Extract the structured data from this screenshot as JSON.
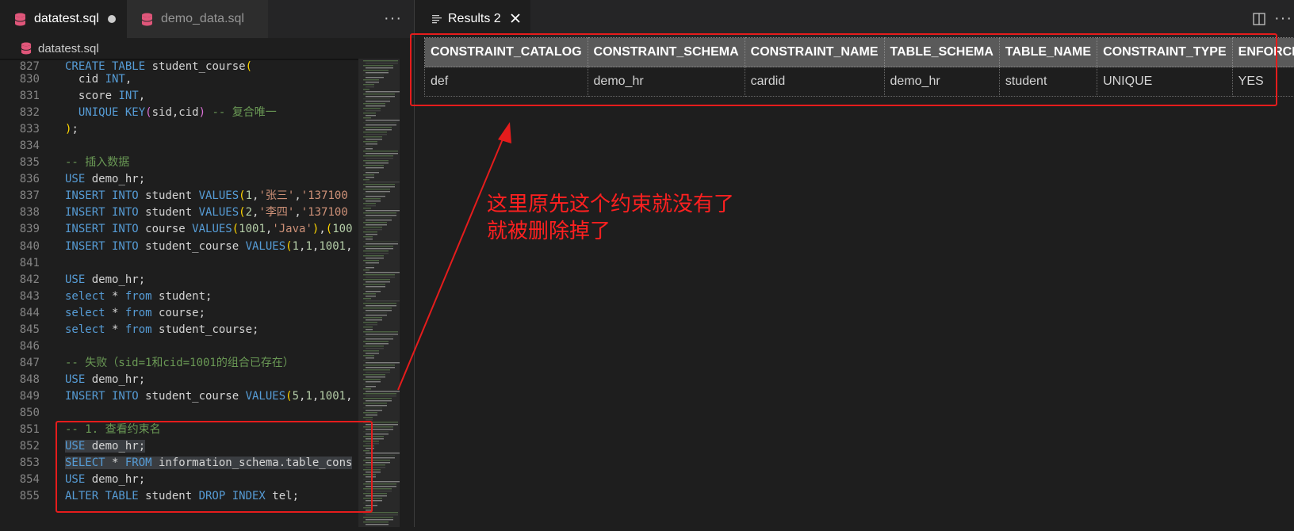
{
  "editor": {
    "tabs": [
      {
        "label": "datatest.sql",
        "active": true,
        "dirty": true
      },
      {
        "label": "demo_data.sql",
        "active": false
      }
    ],
    "more_label": "···",
    "breadcrumb": "datatest.sql",
    "lines": [
      {
        "n": "827",
        "html": "<span class='kw'>CREATE TABLE</span> student_course<span class='br'>(</span>"
      },
      {
        "n": "830",
        "html": "  cid <span class='kw'>INT</span>,"
      },
      {
        "n": "831",
        "html": "  score <span class='kw'>INT</span>,"
      },
      {
        "n": "832",
        "html": "  <span class='kw'>UNIQUE KEY</span><span class='br2'>(</span>sid,cid<span class='br2'>)</span> <span class='cm'>-- 复合唯一</span>"
      },
      {
        "n": "833",
        "html": "<span class='br'>)</span>;"
      },
      {
        "n": "834",
        "html": ""
      },
      {
        "n": "835",
        "html": "<span class='cm'>-- 插入数据</span>"
      },
      {
        "n": "836",
        "html": "<span class='kw'>USE</span> demo_hr;"
      },
      {
        "n": "837",
        "html": "<span class='kw'>INSERT INTO</span> student <span class='kw'>VALUES</span><span class='br'>(</span><span class='nm'>1</span>,<span class='st'>'张三'</span>,<span class='st'>'137100</span>"
      },
      {
        "n": "838",
        "html": "<span class='kw'>INSERT INTO</span> student <span class='kw'>VALUES</span><span class='br'>(</span><span class='nm'>2</span>,<span class='st'>'李四'</span>,<span class='st'>'137100</span>"
      },
      {
        "n": "839",
        "html": "<span class='kw'>INSERT INTO</span> course <span class='kw'>VALUES</span><span class='br'>(</span><span class='nm'>1001</span>,<span class='st'>'Java'</span><span class='br'>)</span>,<span class='br'>(</span><span class='nm'>100</span>"
      },
      {
        "n": "840",
        "html": "<span class='kw'>INSERT INTO</span> student_course <span class='kw'>VALUES</span><span class='br'>(</span><span class='nm'>1</span>,<span class='nm'>1</span>,<span class='nm'>1001</span>,"
      },
      {
        "n": "841",
        "html": ""
      },
      {
        "n": "842",
        "html": "<span class='kw'>USE</span> demo_hr;"
      },
      {
        "n": "843",
        "html": "<span class='kw'>select</span> * <span class='kw'>from</span> student;"
      },
      {
        "n": "844",
        "html": "<span class='kw'>select</span> * <span class='kw'>from</span> course;"
      },
      {
        "n": "845",
        "html": "<span class='kw'>select</span> * <span class='kw'>from</span> student_course;"
      },
      {
        "n": "846",
        "html": ""
      },
      {
        "n": "847",
        "html": "<span class='cm'>-- 失败（sid=1和cid=1001的组合已存在）</span>"
      },
      {
        "n": "848",
        "html": "<span class='kw'>USE</span> demo_hr;"
      },
      {
        "n": "849",
        "html": "<span class='kw'>INSERT INTO</span> student_course <span class='kw'>VALUES</span><span class='br'>(</span><span class='nm'>5</span>,<span class='nm'>1</span>,<span class='nm'>1001</span>,"
      },
      {
        "n": "850",
        "html": ""
      },
      {
        "n": "851",
        "html": "<span class='cm'>-- 1. 查看约束名</span>"
      },
      {
        "n": "852",
        "html": "<span class='sel'><span class='kw'>USE</span> demo_hr;</span>"
      },
      {
        "n": "853",
        "html": "<span class='sel'><span class='kw'>SELECT</span> * <span class='kw'>FROM</span> information_schema.table_cons</span>"
      },
      {
        "n": "854",
        "html": "<span class='kw'>USE</span> demo_hr;"
      },
      {
        "n": "855",
        "html": "<span class='kw'>ALTER TABLE</span> student <span class='kw'>DROP INDEX</span> tel;"
      }
    ]
  },
  "results": {
    "tab_label": "Results 2",
    "more_label": "···",
    "columns": [
      "CONSTRAINT_CATALOG",
      "CONSTRAINT_SCHEMA",
      "CONSTRAINT_NAME",
      "TABLE_SCHEMA",
      "TABLE_NAME",
      "CONSTRAINT_TYPE",
      "ENFORCED"
    ],
    "rows": [
      [
        "def",
        "demo_hr",
        "cardid",
        "demo_hr",
        "student",
        "UNIQUE",
        "YES"
      ]
    ]
  },
  "annotation": {
    "lines": [
      "这里原先这个约束就没有了",
      "就被删除掉了"
    ],
    "color": "#ff2020"
  },
  "colors": {
    "accent_red": "#e51c1c",
    "db_icon": "#e0567a"
  }
}
